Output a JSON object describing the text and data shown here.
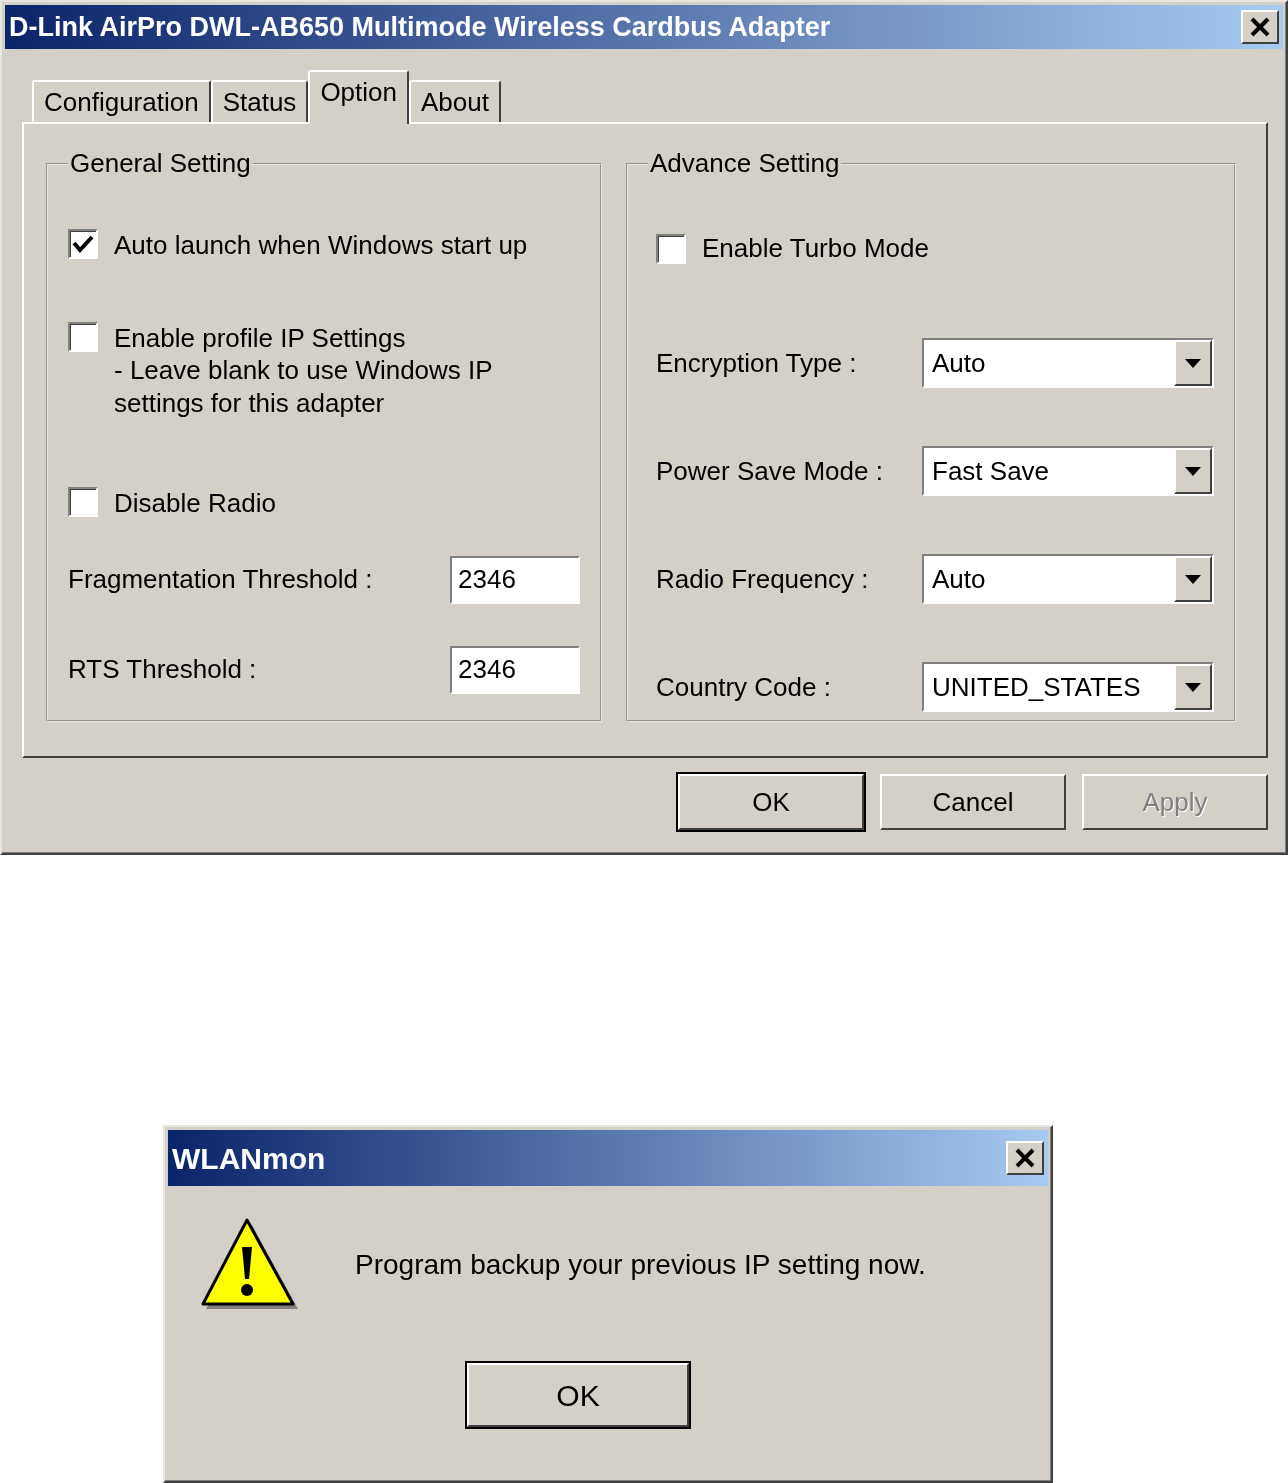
{
  "main_window": {
    "title": "D-Link AirPro DWL-AB650 Multimode Wireless Cardbus Adapter",
    "tabs": [
      {
        "label": "Configuration",
        "selected": false
      },
      {
        "label": "Status",
        "selected": false
      },
      {
        "label": "Option",
        "selected": true
      },
      {
        "label": "About",
        "selected": false
      }
    ],
    "general_setting": {
      "title": "General Setting",
      "checkboxes": [
        {
          "label": "Auto launch when Windows start up",
          "checked": true
        },
        {
          "label": "Enable profile IP Settings",
          "note": "- Leave blank to use Windows IP settings for this adapter",
          "checked": false
        },
        {
          "label": "Disable Radio",
          "checked": false
        }
      ],
      "fields": [
        {
          "label": "Fragmentation Threshold :",
          "value": "2346"
        },
        {
          "label": "RTS Threshold :",
          "value": "2346"
        }
      ]
    },
    "advance_setting": {
      "title": "Advance Setting",
      "checkboxes": [
        {
          "label": "Enable Turbo Mode",
          "checked": false
        }
      ],
      "dropdowns": [
        {
          "label": "Encryption Type :",
          "value": "Auto"
        },
        {
          "label": "Power Save Mode :",
          "value": "Fast Save"
        },
        {
          "label": "Radio Frequency :",
          "value": "Auto"
        },
        {
          "label": "Country Code :",
          "value": "UNITED_STATES"
        }
      ]
    },
    "buttons": [
      {
        "label": "OK",
        "disabled": false,
        "default": true
      },
      {
        "label": "Cancel",
        "disabled": false,
        "default": false
      },
      {
        "label": "Apply",
        "disabled": true,
        "default": false
      }
    ]
  },
  "message_box": {
    "title": "WLANmon",
    "message": "Program backup your previous IP setting now.",
    "buttons": [
      {
        "label": "OK",
        "disabled": false,
        "default": true
      }
    ]
  }
}
